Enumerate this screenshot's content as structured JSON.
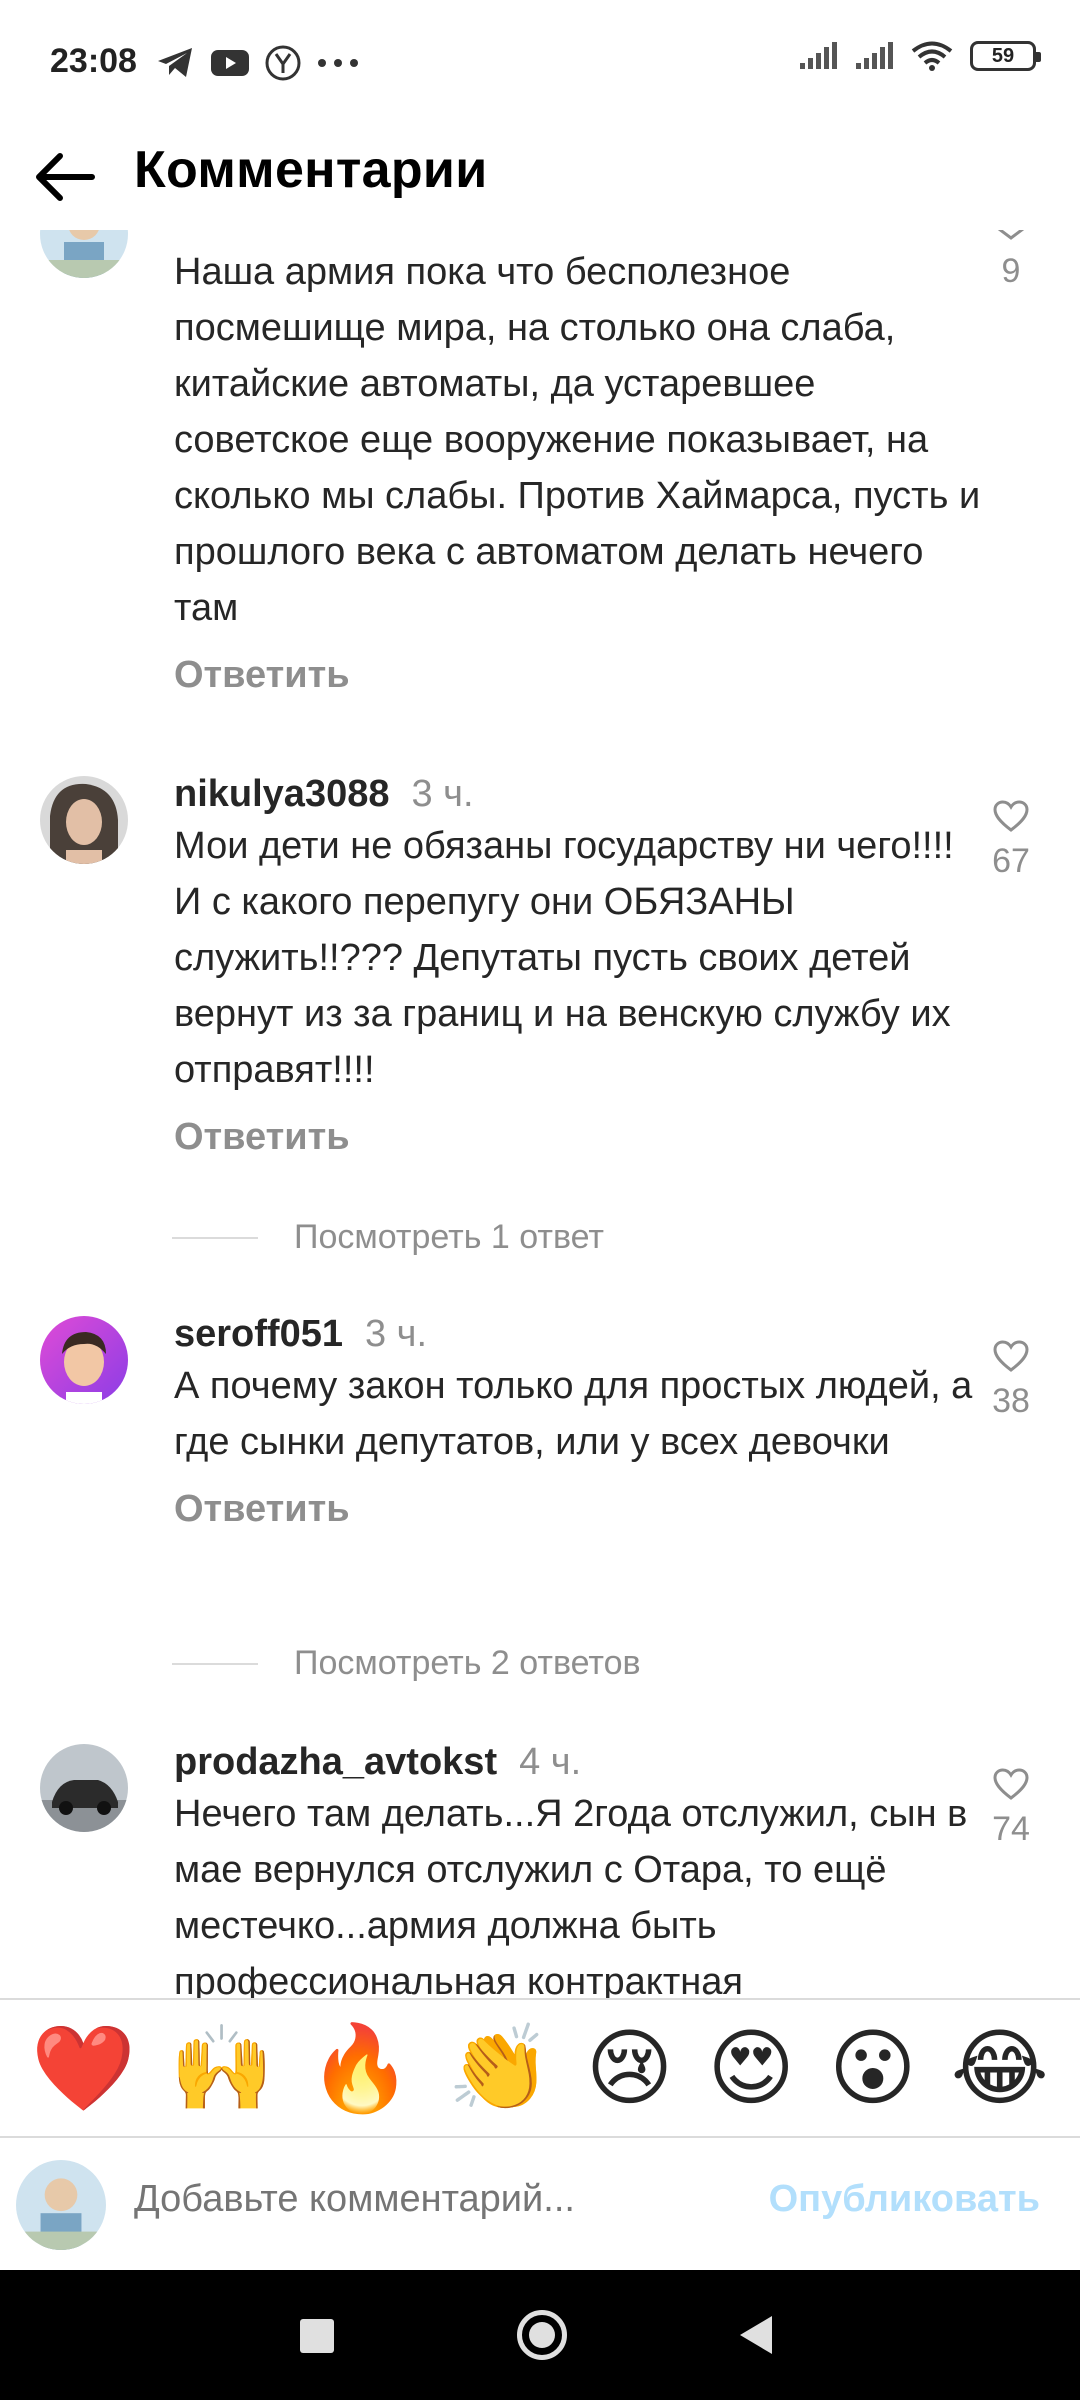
{
  "status_bar": {
    "time": "23:08",
    "battery": "59",
    "left_icons": [
      "telegram-icon",
      "youtube-icon",
      "yandex-icon",
      "more-dots-icon"
    ],
    "right_icons": [
      "signal-icon",
      "signal-icon",
      "wifi-icon",
      "battery-icon"
    ]
  },
  "header": {
    "title": "Комментарии",
    "back_icon": "arrow-left-icon"
  },
  "comments": [
    {
      "username": "",
      "time": "",
      "text": "Наша армия пока что бесполезное посмешище мира, на столько она слаба, китайские автоматы, да устаревшее советское еще вооружение показывает, на сколько мы слабы. Против Хаймарса, пусть и прошлого века с автоматом делать нечего там",
      "reply_label": "Ответить",
      "likes": "9"
    },
    {
      "username": "nikulya3088",
      "time": "3 ч.",
      "text": "Мои дети не обязаны государству ни чего!!!! И с какого перепугу они ОБЯЗАНЫ служить!!??? Депутаты пусть своих детей вернут из за границ и на венскую службу их отправят!!!!",
      "reply_label": "Ответить",
      "likes": "67",
      "view_replies": "Посмотреть 1 ответ"
    },
    {
      "username": "seroff051",
      "time": "3 ч.",
      "text": "А почему закон только для простых людей, а где сынки депутатов, или у всех девочки",
      "reply_label": "Ответить",
      "likes": "38",
      "view_replies": "Посмотреть 2 ответов"
    },
    {
      "username": "prodazha_avtokst",
      "time": "4 ч.",
      "text": "Нечего там делать...Я 2года отслужил, сын в мае вернулся отслужил с Отара, то ещё местечко...армия должна быть профессиональная контрактная",
      "likes": "74"
    }
  ],
  "emoji_bar": [
    "❤️",
    "🙌",
    "🔥",
    "👏",
    "😢",
    "😍",
    "😮",
    "😂"
  ],
  "compose": {
    "placeholder": "Добавьте комментарий...",
    "publish_label": "Опубликовать"
  },
  "colors": {
    "muted": "#8e8e8e",
    "publish_disabled": "#b2dffc",
    "divider": "#dbdbdb"
  }
}
